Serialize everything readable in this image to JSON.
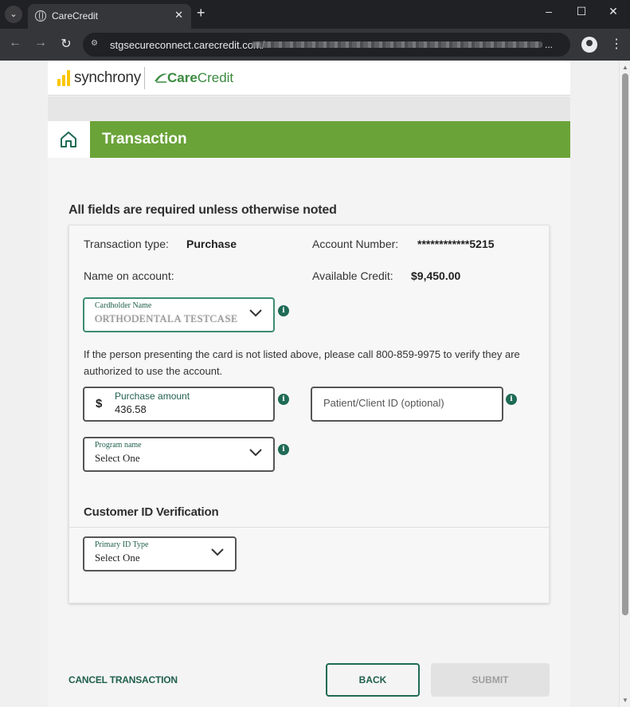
{
  "browser": {
    "tab_title": "CareCredit",
    "url_visible": "stgsecureconnect.carecredit.com/",
    "url_ellipsis": "..."
  },
  "brand": {
    "synchrony_text": "synchrony",
    "carecredit_bold": "Care",
    "carecredit_light": "Credit",
    "accent_green": "#6aa338",
    "dark_green": "#1f6b55",
    "logo_yellow": "#fbc600"
  },
  "header": {
    "title": "Transaction"
  },
  "form": {
    "required_note": "All fields are required unless otherwise noted",
    "transaction_type_label": "Transaction type:",
    "transaction_type_value": "Purchase",
    "account_number_label": "Account Number:",
    "account_number_value": "************5215",
    "name_on_account_label": "Name on account:",
    "available_credit_label": "Available Credit:",
    "available_credit_value": "$9,450.00",
    "cardholder": {
      "label": "Cardholder Name",
      "value": "ORTHODENTALA TESTCASE"
    },
    "verify_note": "If the person presenting the card is not listed above, please call 800-859-9975 to verify they are authorized to use the account.",
    "purchase_amount": {
      "currency": "$",
      "label": "Purchase amount",
      "value": "436.58"
    },
    "patient_id": {
      "placeholder": "Patient/Client ID (optional)"
    },
    "program_name": {
      "label": "Program name",
      "value": "Select One"
    },
    "customer_id_section": "Customer ID Verification",
    "primary_id_type": {
      "label": "Primary ID Type",
      "value": "Select One"
    },
    "info_glyph": "i"
  },
  "actions": {
    "cancel": "CANCEL TRANSACTION",
    "back": "BACK",
    "submit": "SUBMIT"
  }
}
